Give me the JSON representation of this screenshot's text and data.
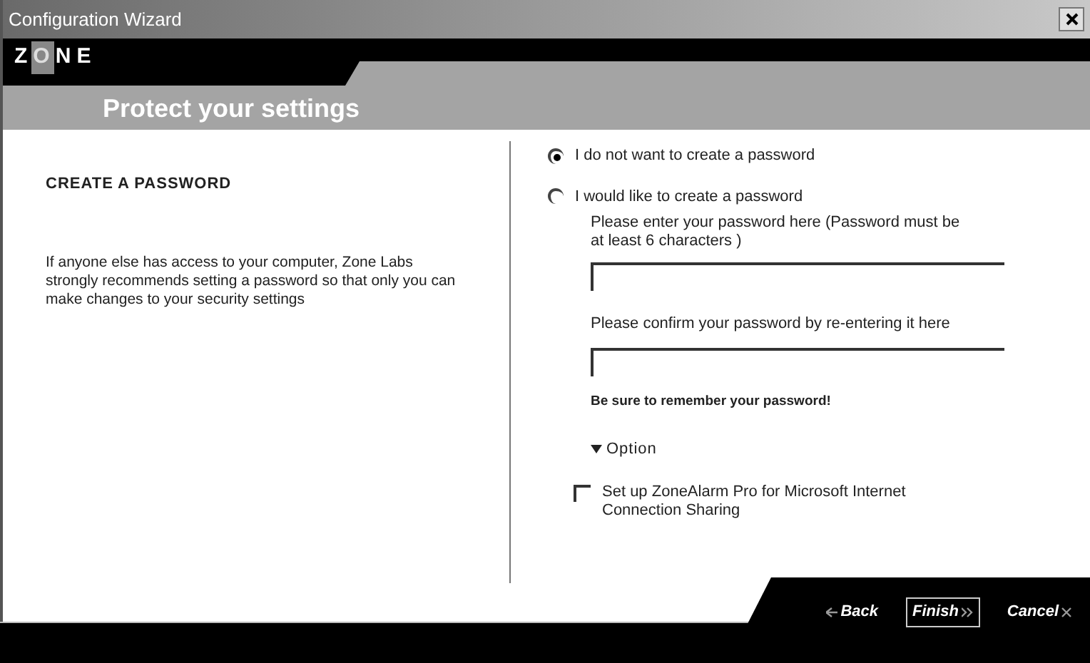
{
  "window": {
    "title": "Configuration Wizard"
  },
  "header": {
    "logo": "ZONE",
    "title": "Protect your settings"
  },
  "left_panel": {
    "heading": "CREATE A PASSWORD",
    "description": "If anyone else has access to your computer, Zone Labs strongly recommends setting a password so that only you can make changes to your security settings"
  },
  "password_options": [
    {
      "label": "I do not want to create a password",
      "selected": true
    },
    {
      "label": "I would like to create a password",
      "selected": false
    }
  ],
  "password_prompt": "Please enter your password here  (Password must be at least 6 characters )",
  "confirm_prompt": "Please confirm your password by re-entering it here",
  "reminder": "Be sure to remember your password!",
  "options_section": {
    "label": "Option",
    "expanded": true
  },
  "ics_checkbox": {
    "label": "Set up ZoneAlarm Pro for Microsoft Internet Connection Sharing",
    "checked": false
  },
  "buttons": [
    {
      "label": "Back",
      "kind": "back",
      "default": false
    },
    {
      "label": "Finish",
      "kind": "finish",
      "default": true
    },
    {
      "label": "Cancel",
      "kind": "cancel",
      "default": false
    }
  ]
}
